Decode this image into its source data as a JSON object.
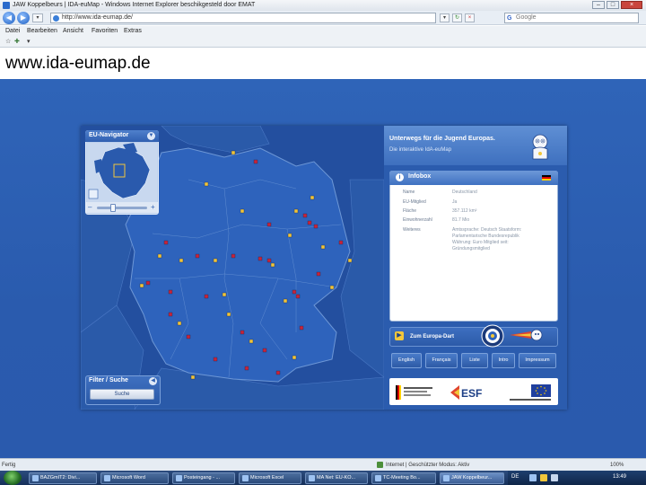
{
  "window": {
    "title": "JAW Koppelbeurs | IDA-euMap - Windows Internet Explorer beschikgesteld door EMAT",
    "buttons": {
      "minimize": "–",
      "maximize": "□",
      "close": "×"
    }
  },
  "browser": {
    "back_icon": "back-arrow-icon",
    "forward_icon": "forward-arrow-icon",
    "address": "http://www.ida-eumap.de/",
    "search_placeholder": "Google",
    "search_logo": "G",
    "menu": [
      "Datei",
      "Bearbeiten",
      "Ansicht",
      "Favoriten",
      "Extras"
    ],
    "status_left": "Fertig",
    "status_zone": "Internet | Geschützter Modus: Aktiv",
    "status_zoom": "100%"
  },
  "page": {
    "heading": "www.ida-eumap.de"
  },
  "app": {
    "panel_title": "Unterwegs für die Jugend Europas.",
    "panel_subtitle": "Die interaktive IdA-euMap",
    "eu_navigator": {
      "title": "EU-Navigator",
      "zoom_minus": "–",
      "zoom_plus": "+",
      "zoom_level": 0.3
    },
    "infobox": {
      "title": "Infobox",
      "rows": [
        {
          "label": "Name",
          "value": "Deutschland"
        },
        {
          "label": "EU-Mitglied",
          "value": "Ja"
        },
        {
          "label": "Fläche",
          "value": "357.112 km²"
        },
        {
          "label": "Einwohnerzahl",
          "value": "81.7 Mio"
        },
        {
          "label": "Weiteres",
          "value": "Amtssprache: Deutsch Staatsform: Parlamentarische Bundesrepublik Währung: Euro Mitglied seit: Gründungsmitglied"
        }
      ],
      "flag_colors": [
        "#000000",
        "#dd0000",
        "#ffce00"
      ]
    },
    "europe_dart": {
      "label": "Zum Europa-Dart"
    },
    "language_buttons": [
      "English",
      "Français",
      "Liste",
      "Intro",
      "Impressum"
    ],
    "filter": {
      "title": "Filter / Suche",
      "search_button": "Suche"
    },
    "logos": [
      {
        "name": "Bundesministerium",
        "text": "Bundesministerium für Arbeit und Soziales"
      },
      {
        "name": "esf",
        "text": "ESF"
      },
      {
        "name": "eu",
        "text": "EUROPÄISCHE UNION"
      }
    ]
  },
  "taskbar": {
    "items": [
      "BAZGmIT2: Divi...",
      "Microsoft Word",
      "Posteingang - ...",
      "Microsoft Excel",
      "MA Net: EU-KO...",
      "TC-Meeting Bo...",
      "JAW Koppelbeur..."
    ],
    "tray_lang": "DE",
    "clock": "13:49"
  },
  "colors": {
    "page_blue": "#2a5bae",
    "map_land": "#2d62b9",
    "marker_red": "#c8233a",
    "marker_yellow": "#f0c43a"
  }
}
